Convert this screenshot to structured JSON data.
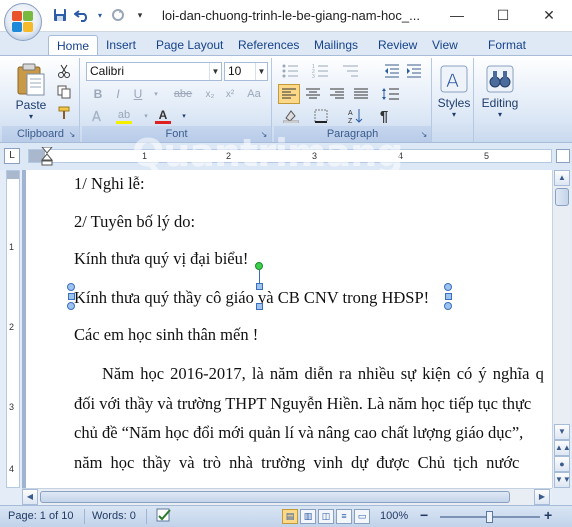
{
  "titlebar": {
    "title": "loi-dan-chuong-trinh-le-be-giang-nam-hoc_...",
    "minimize": "—",
    "maximize": "☐",
    "close": "✕"
  },
  "qat": {
    "save_icon": "save-icon",
    "undo_icon": "undo-icon",
    "redo_icon": "redo-icon",
    "customize_icon": "chevron-down-icon"
  },
  "tabs": [
    {
      "label": "Home",
      "active": true
    },
    {
      "label": "Insert"
    },
    {
      "label": "Page Layout"
    },
    {
      "label": "References"
    },
    {
      "label": "Mailings"
    },
    {
      "label": "Review"
    },
    {
      "label": "View"
    },
    {
      "label": "Format"
    }
  ],
  "ribbon": {
    "clipboard": {
      "label": "Clipboard",
      "paste_label": "Paste"
    },
    "font": {
      "label": "Font",
      "font_name": "Calibri",
      "font_size": "10",
      "bold": "B",
      "italic": "I",
      "underline": "U",
      "strike": "abe",
      "font_color": "A",
      "highlight": "ab"
    },
    "paragraph": {
      "label": "Paragraph"
    },
    "styles": {
      "label": "Styles"
    },
    "editing": {
      "label": "Editing"
    }
  },
  "ruler": {
    "numbers": [
      "1",
      "2",
      "3",
      "4",
      "5"
    ],
    "v_numbers": [
      "1",
      "2",
      "3",
      "4"
    ]
  },
  "document": {
    "lines": [
      "1/ Nghi lễ:",
      "2/ Tuyên bố lý do:",
      "Kính thưa quý vị đại biểu!",
      "Kính thưa quý thầy cô giáo và CB CNV trong HĐSP!",
      "Các em học sinh thân mến !",
      "Năm học 2016-2017, là năm diễn ra nhiều sự kiện có ý nghĩa q",
      "đối với thầy và trường THPT Nguyễn Hiền. Là năm học tiếp tục thực",
      "chủ đề “Năm học đổi mới quản lí và nâng cao chất lượng giáo dục”,",
      "năm học thầy và trò nhà trường vinh dự  được Chủ tịch nước"
    ],
    "watermark": "Quantrimang"
  },
  "status": {
    "page": "Page: 1 of 10",
    "words": "Words: 0",
    "zoom": "100%",
    "zoom_out": "−",
    "zoom_in": "+"
  },
  "colors": {
    "accent": "#15428b",
    "ribbon_bg": "#dde8f6",
    "font_color_bar": "#e02020",
    "highlight_bar": "#f5f000"
  }
}
